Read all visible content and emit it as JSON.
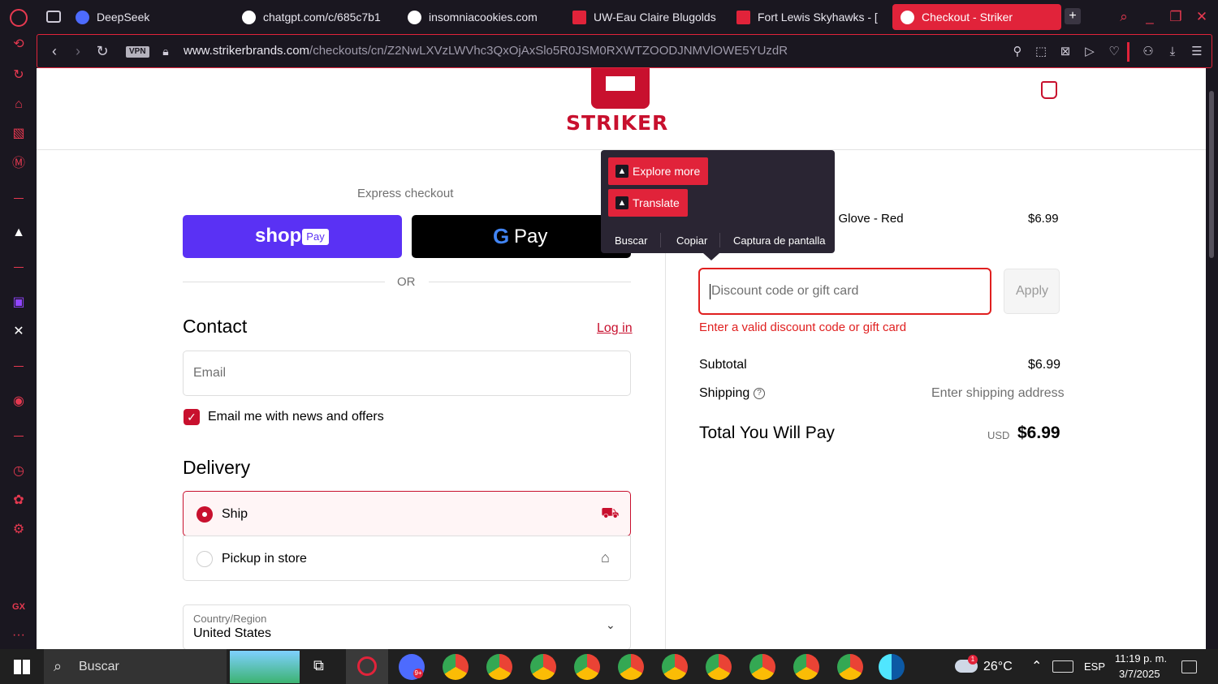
{
  "tabs": [
    {
      "label": "DeepSeek",
      "fav_color": "#4d6bfe"
    },
    {
      "label": "chatgpt.com/c/685c7b1",
      "fav_color": "#ffffff"
    },
    {
      "label": "insomniacookies.com",
      "fav_color": "#ffffff"
    },
    {
      "label": "UW-Eau Claire Blugolds",
      "fav_color": "#e1233a"
    },
    {
      "label": "Fort Lewis Skyhawks - [",
      "fav_color": "#e1233a"
    },
    {
      "label": "Checkout - Striker",
      "fav_color": "#ffffff",
      "active": true
    }
  ],
  "address": {
    "vpn": "VPN",
    "host": "www.strikerbrands.com",
    "path": "/checkouts/cn/Z2NwLXVzLWVhc3QxOjAxSlo5R0JSM0RXWTZOODJNMVlOWE5YUzdR"
  },
  "store": {
    "logo_text": "STRIKER",
    "accent": "#c8102e"
  },
  "express": {
    "label": "Express checkout",
    "shop_label": "shop",
    "shop_pay_badge": "Pay",
    "gpay_label": "Pay",
    "or": "OR"
  },
  "contact": {
    "title": "Contact",
    "login": "Log in",
    "email_placeholder": "Email",
    "newsletter": "Email me with news and offers"
  },
  "delivery": {
    "title": "Delivery",
    "options": [
      {
        "label": "Ship",
        "selected": true
      },
      {
        "label": "Pickup in store",
        "selected": false
      }
    ],
    "country_label": "Country/Region",
    "country_value": "United States"
  },
  "order": {
    "item_name": "d Glove - Red",
    "item_price": "$6.99",
    "discount_placeholder": "Discount code or gift card",
    "apply": "Apply",
    "discount_error": "Enter a valid discount code or gift card",
    "subtotal_label": "Subtotal",
    "subtotal_value": "$6.99",
    "shipping_label": "Shipping",
    "shipping_value": "Enter shipping address",
    "total_label": "Total You Will Pay",
    "total_currency": "USD",
    "total_value": "$6.99"
  },
  "popup": {
    "explore": "Explore more",
    "translate": "Translate",
    "search": "Buscar",
    "copy": "Copiar",
    "screenshot": "Captura de pantalla"
  },
  "taskbar": {
    "search": "Buscar",
    "weather": "26°C",
    "lang": "ESP",
    "time": "11:19 p. m.",
    "date": "3/7/2025",
    "weather_badge": "1",
    "opera_badge": "9+"
  }
}
